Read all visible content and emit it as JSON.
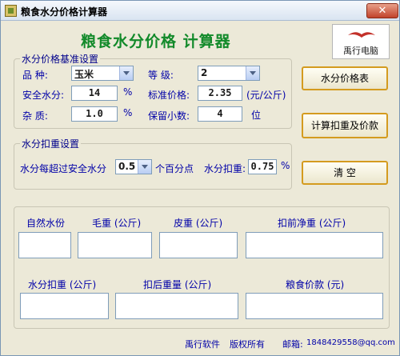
{
  "window": {
    "title": "粮食水分价格计算器",
    "close_glyph": "✕"
  },
  "main_title": "粮食水分价格  计算器",
  "logo": {
    "text": "禹行电脑"
  },
  "base_settings": {
    "legend": "水分价格基准设置",
    "variety_label": "品    种:",
    "variety_value": "玉米",
    "grade_label": "等    级:",
    "grade_value": "2",
    "safe_moisture_label": "安全水分:",
    "safe_moisture_value": "14",
    "safe_moisture_unit": "%",
    "standard_price_label": "标准价格:",
    "standard_price_value": "2.35",
    "standard_price_unit": "(元/公斤)",
    "impurity_label": "杂    质:",
    "impurity_value": "1.0",
    "impurity_unit": "%",
    "decimals_label": "保留小数:",
    "decimals_value": "4",
    "decimals_unit": "位"
  },
  "deduct_settings": {
    "legend": "水分扣重设置",
    "exceed_label": "水分每超过安全水分",
    "exceed_value": "0.5",
    "exceed_unit": "个百分点",
    "deduct_label": "水分扣重:",
    "deduct_value": "0.75",
    "deduct_unit": "%"
  },
  "buttons": {
    "price_table": "水分价格表",
    "calculate": "计算扣重及价款",
    "clear": "清    空"
  },
  "results": {
    "natural_moisture": "自然水份",
    "gross_weight": "毛重 (公斤)",
    "tare_weight": "皮重 (公斤)",
    "net_before": "扣前净重 (公斤)",
    "moisture_deduct": "水分扣重 (公斤)",
    "weight_after": "扣后重量 (公斤)",
    "grain_payment": "粮食价款 (元)"
  },
  "footer": {
    "company": "禹行软件",
    "copyright": "版权所有",
    "email_label": "邮箱:",
    "email": "1848429558@qq.com"
  }
}
